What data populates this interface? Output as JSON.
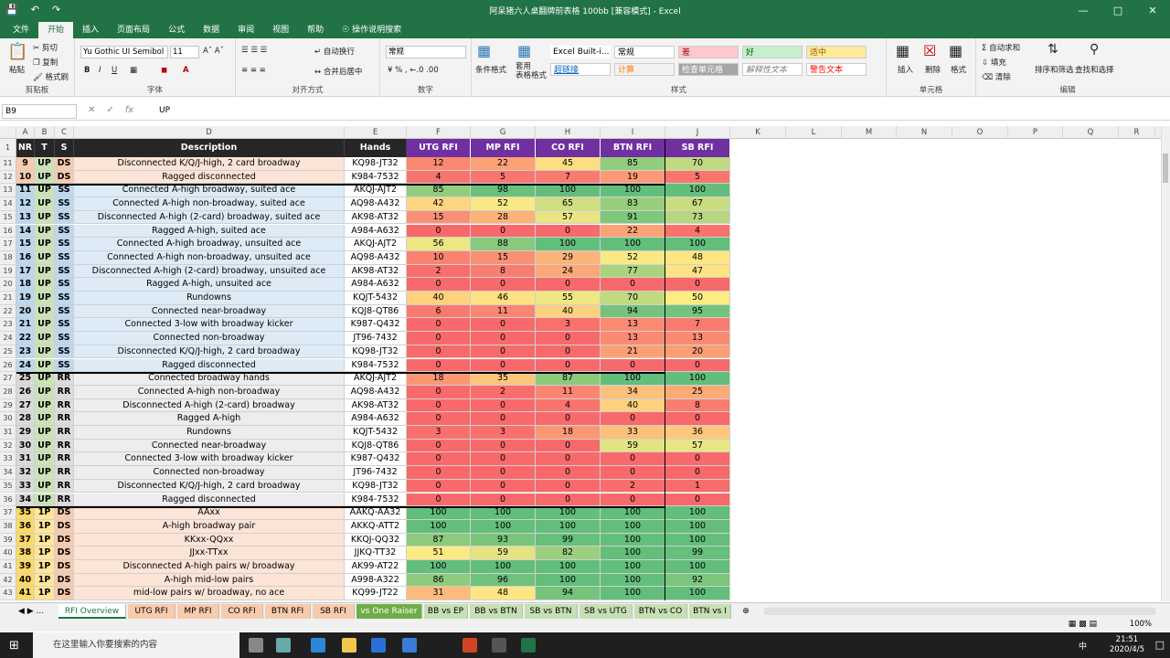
{
  "title": "阿呆猪六人桌翻牌前表格 100bb  [兼容模式]  -  Excel",
  "tabs": [
    "文件",
    "开始",
    "插入",
    "页面布局",
    "公式",
    "数据",
    "审阅",
    "视图",
    "帮助",
    "操作说明搜索"
  ],
  "ribbon": {
    "paste": "粘贴",
    "cut": "剪切",
    "copy": "复制",
    "painter": "格式刷",
    "clipboard": "剪贴板",
    "font_name": "Yu Gothic UI Semibol",
    "font_size": "11",
    "font_group": "字体",
    "wrap": "自动换行",
    "merge": "合并后居中",
    "align_group": "对齐方式",
    "number_format": "常规",
    "number_group": "数字",
    "cond_format": "条件格式",
    "table_format": "套用\n表格格式",
    "styles": [
      "Excel Built-i...",
      "常规",
      "差",
      "好",
      "适中",
      "超链接",
      "计算",
      "检查单元格",
      "解释性文本",
      "警告文本"
    ],
    "styles_group": "样式",
    "insert": "插入",
    "delete": "删除",
    "format": "格式",
    "cells_group": "单元格",
    "autosum": "自动求和",
    "fill": "填充",
    "clear": "清除",
    "sort": "排序和筛选",
    "find": "查找和选择",
    "edit_group": "编辑"
  },
  "namebox": "B9",
  "formula": "UP",
  "columns": [
    "A",
    "B",
    "C",
    "D",
    "E",
    "F",
    "G",
    "H",
    "I",
    "J",
    "K",
    "L",
    "M",
    "N",
    "O",
    "P",
    "Q",
    "R"
  ],
  "headers": [
    "NR",
    "T",
    "S",
    "Description",
    "Hands",
    "UTG RFI",
    "MP RFI",
    "CO RFI",
    "BTN RFI",
    "SB RFI"
  ],
  "rows": [
    {
      "r": "11",
      "nr": "9",
      "t": "UP",
      "s": "DS",
      "d": "Disconnected K/Q/J-high, 2 card broadway",
      "h": "KQ98-JT32",
      "v": [
        12,
        22,
        45,
        85,
        70
      ]
    },
    {
      "r": "12",
      "nr": "10",
      "t": "UP",
      "s": "DS",
      "d": "Ragged disconnected",
      "h": "K984-7532",
      "v": [
        4,
        5,
        7,
        19,
        5
      ]
    },
    {
      "r": "13",
      "nr": "11",
      "t": "UP",
      "s": "SS",
      "d": "Connected A-high broadway, suited ace",
      "h": "AKQJ-AJT2",
      "v": [
        85,
        98,
        100,
        100,
        100
      ]
    },
    {
      "r": "14",
      "nr": "12",
      "t": "UP",
      "s": "SS",
      "d": "Connected A-high non-broadway, suited ace",
      "h": "AQ98-A432",
      "v": [
        42,
        52,
        65,
        83,
        67
      ]
    },
    {
      "r": "15",
      "nr": "13",
      "t": "UP",
      "s": "SS",
      "d": "Disconnected A-high (2-card) broadway, suited ace",
      "h": "AK98-AT32",
      "v": [
        15,
        28,
        57,
        91,
        73
      ]
    },
    {
      "r": "16",
      "nr": "14",
      "t": "UP",
      "s": "SS",
      "d": "Ragged A-high, suited ace",
      "h": "A984-A632",
      "v": [
        0,
        0,
        0,
        22,
        4
      ]
    },
    {
      "r": "17",
      "nr": "15",
      "t": "UP",
      "s": "SS",
      "d": "Connected A-high broadway, unsuited ace",
      "h": "AKQJ-AJT2",
      "v": [
        56,
        88,
        100,
        100,
        100
      ]
    },
    {
      "r": "18",
      "nr": "16",
      "t": "UP",
      "s": "SS",
      "d": "Connected A-high non-broadway, unsuited ace",
      "h": "AQ98-A432",
      "v": [
        10,
        15,
        29,
        52,
        48
      ]
    },
    {
      "r": "19",
      "nr": "17",
      "t": "UP",
      "s": "SS",
      "d": "Disconnected A-high (2-card) broadway, unsuited ace",
      "h": "AK98-AT32",
      "v": [
        2,
        8,
        24,
        77,
        47
      ]
    },
    {
      "r": "20",
      "nr": "18",
      "t": "UP",
      "s": "SS",
      "d": "Ragged A-high, unsuited ace",
      "h": "A984-A632",
      "v": [
        0,
        0,
        0,
        0,
        0
      ]
    },
    {
      "r": "21",
      "nr": "19",
      "t": "UP",
      "s": "SS",
      "d": "Rundowns",
      "h": "KQJT-5432",
      "v": [
        40,
        46,
        55,
        70,
        50
      ]
    },
    {
      "r": "22",
      "nr": "20",
      "t": "UP",
      "s": "SS",
      "d": "Connected near-broadway",
      "h": "KQJ8-QT86",
      "v": [
        6,
        11,
        40,
        94,
        95
      ]
    },
    {
      "r": "23",
      "nr": "21",
      "t": "UP",
      "s": "SS",
      "d": "Connected 3-low with broadway kicker",
      "h": "K987-Q432",
      "v": [
        0,
        0,
        3,
        13,
        7
      ]
    },
    {
      "r": "24",
      "nr": "22",
      "t": "UP",
      "s": "SS",
      "d": "Connected non-broadway",
      "h": "JT96-7432",
      "v": [
        0,
        0,
        0,
        13,
        13
      ]
    },
    {
      "r": "25",
      "nr": "23",
      "t": "UP",
      "s": "SS",
      "d": "Disconnected K/Q/J-high, 2 card broadway",
      "h": "KQ98-JT32",
      "v": [
        0,
        0,
        0,
        21,
        20
      ]
    },
    {
      "r": "26",
      "nr": "24",
      "t": "UP",
      "s": "SS",
      "d": "Ragged disconnected",
      "h": "K984-7532",
      "v": [
        0,
        0,
        0,
        0,
        0
      ]
    },
    {
      "r": "27",
      "nr": "25",
      "t": "UP",
      "s": "RR",
      "d": "Connected broadway hands",
      "h": "AKQJ-AJT2",
      "v": [
        18,
        35,
        87,
        100,
        100
      ]
    },
    {
      "r": "28",
      "nr": "26",
      "t": "UP",
      "s": "RR",
      "d": "Connected A-high non-broadway",
      "h": "AQ98-A432",
      "v": [
        0,
        2,
        11,
        34,
        25
      ]
    },
    {
      "r": "29",
      "nr": "27",
      "t": "UP",
      "s": "RR",
      "d": "Disconnected A-high (2-card) broadway",
      "h": "AK98-AT32",
      "v": [
        0,
        0,
        4,
        40,
        8
      ]
    },
    {
      "r": "30",
      "nr": "28",
      "t": "UP",
      "s": "RR",
      "d": "Ragged A-high",
      "h": "A984-A632",
      "v": [
        0,
        0,
        0,
        0,
        0
      ]
    },
    {
      "r": "31",
      "nr": "29",
      "t": "UP",
      "s": "RR",
      "d": "Rundowns",
      "h": "KQJT-5432",
      "v": [
        3,
        3,
        18,
        33,
        36
      ]
    },
    {
      "r": "32",
      "nr": "30",
      "t": "UP",
      "s": "RR",
      "d": "Connected near-broadway",
      "h": "KQJ8-QT86",
      "v": [
        0,
        0,
        0,
        59,
        57
      ]
    },
    {
      "r": "33",
      "nr": "31",
      "t": "UP",
      "s": "RR",
      "d": "Connected 3-low with broadway kicker",
      "h": "K987-Q432",
      "v": [
        0,
        0,
        0,
        0,
        0
      ]
    },
    {
      "r": "34",
      "nr": "32",
      "t": "UP",
      "s": "RR",
      "d": "Connected non-broadway",
      "h": "JT96-7432",
      "v": [
        0,
        0,
        0,
        0,
        0
      ]
    },
    {
      "r": "35",
      "nr": "33",
      "t": "UP",
      "s": "RR",
      "d": "Disconnected K/Q/J-high, 2 card broadway",
      "h": "KQ98-JT32",
      "v": [
        0,
        0,
        0,
        2,
        1
      ]
    },
    {
      "r": "36",
      "nr": "34",
      "t": "UP",
      "s": "RR",
      "d": "Ragged disconnected",
      "h": "K984-7532",
      "v": [
        0,
        0,
        0,
        0,
        0
      ]
    },
    {
      "r": "37",
      "nr": "35",
      "t": "1P",
      "s": "DS",
      "d": "AAxx",
      "h": "AAKQ-AA32",
      "v": [
        100,
        100,
        100,
        100,
        100
      ]
    },
    {
      "r": "38",
      "nr": "36",
      "t": "1P",
      "s": "DS",
      "d": "A-high broadway pair",
      "h": "AKKQ-ATT2",
      "v": [
        100,
        100,
        100,
        100,
        100
      ]
    },
    {
      "r": "39",
      "nr": "37",
      "t": "1P",
      "s": "DS",
      "d": "KKxx-QQxx",
      "h": "KKQJ-QQ32",
      "v": [
        87,
        93,
        99,
        100,
        100
      ]
    },
    {
      "r": "40",
      "nr": "38",
      "t": "1P",
      "s": "DS",
      "d": "JJxx-TTxx",
      "h": "JJKQ-TT32",
      "v": [
        51,
        59,
        82,
        100,
        99
      ]
    },
    {
      "r": "41",
      "nr": "39",
      "t": "1P",
      "s": "DS",
      "d": "Disconnected A-high pairs w/ broadway",
      "h": "AK99-AT22",
      "v": [
        100,
        100,
        100,
        100,
        100
      ]
    },
    {
      "r": "42",
      "nr": "40",
      "t": "1P",
      "s": "DS",
      "d": "A-high mid-low pairs",
      "h": "A998-A322",
      "v": [
        86,
        96,
        100,
        100,
        92
      ]
    },
    {
      "r": "43",
      "nr": "41",
      "t": "1P",
      "s": "DS",
      "d": "mid-low pairs w/ broadway, no ace",
      "h": "KQ99-JT22",
      "v": [
        31,
        48,
        94,
        100,
        100
      ]
    }
  ],
  "sheet_tabs": [
    "RFI Overview",
    "UTG RFI",
    "MP RFI",
    "CO RFI",
    "BTN RFI",
    "SB RFI",
    "vs One Raiser",
    "BB vs EP",
    "BB vs BTN",
    "SB vs BTN",
    "SB vs UTG",
    "BTN vs CO",
    "BTN vs I"
  ],
  "zoom": "100%",
  "taskbar": {
    "search": "在这里输入你要搜索的内容",
    "time": "21:51",
    "date": "2020/4/5",
    "ime": "中"
  },
  "colors": {
    "excel_green": "#217346",
    "header_dark": "#262626",
    "header_purple": "#7030a0"
  }
}
